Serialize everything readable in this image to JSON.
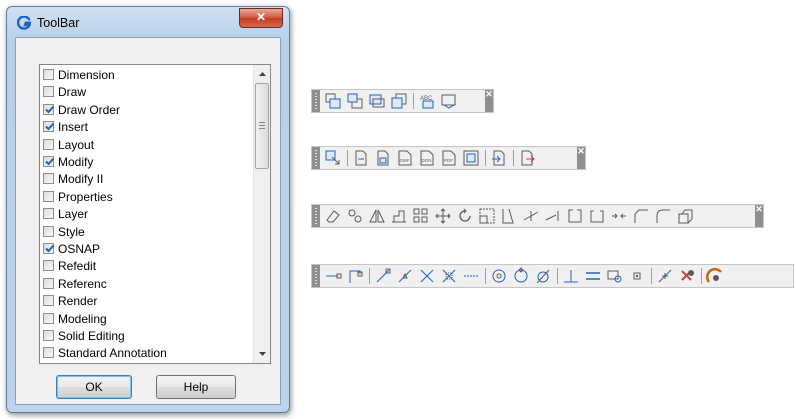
{
  "dialog": {
    "title": "ToolBar",
    "close_glyph": "✕",
    "items": [
      {
        "label": "Dimension",
        "checked": false
      },
      {
        "label": "Draw",
        "checked": false
      },
      {
        "label": "Draw Order",
        "checked": true
      },
      {
        "label": "Insert",
        "checked": true
      },
      {
        "label": "Layout",
        "checked": false
      },
      {
        "label": "Modify",
        "checked": true
      },
      {
        "label": "Modify II",
        "checked": false
      },
      {
        "label": "Properties",
        "checked": false
      },
      {
        "label": "Layer",
        "checked": false
      },
      {
        "label": "Style",
        "checked": false
      },
      {
        "label": "OSNAP",
        "checked": true
      },
      {
        "label": "Refedit",
        "checked": false
      },
      {
        "label": "Referenc",
        "checked": false
      },
      {
        "label": "Render",
        "checked": false
      },
      {
        "label": "Modeling",
        "checked": false
      },
      {
        "label": "Solid Editing",
        "checked": false
      },
      {
        "label": "Standard Annotation",
        "checked": false
      }
    ],
    "ok_label": "OK",
    "help_label": "Help"
  },
  "toolbars": {
    "draw_order": {
      "icons": [
        "bring-to-front-icon",
        "send-to-back-icon",
        "bring-above-objects-icon",
        "send-under-objects-icon",
        "|",
        "text-to-front-icon",
        "hatch-to-back-icon"
      ]
    },
    "insert": {
      "icons": [
        "insert-block-icon",
        "|",
        "attach-xref-icon",
        "attach-image-icon",
        "attach-dwf-icon",
        "attach-dgn-icon",
        "attach-pdf-icon",
        "ole-object-icon",
        "|",
        "import-icon",
        "|",
        "export-icon"
      ]
    },
    "modify": {
      "icons": [
        "erase-icon",
        "copy-icon",
        "mirror-icon",
        "offset-icon",
        "array-icon",
        "move-icon",
        "rotate-icon",
        "scale-icon",
        "stretch-icon",
        "trim-icon",
        "extend-icon",
        "break-at-point-icon",
        "break-icon",
        "join-icon",
        "chamfer-icon",
        "fillet-icon",
        "explode-icon"
      ]
    },
    "osnap": {
      "icons": [
        "temporary-tracking-icon",
        "snap-from-icon",
        "|",
        "endpoint-icon",
        "midpoint-icon",
        "intersection-icon",
        "apparent-intersection-icon",
        "extension-icon",
        "|",
        "center-icon",
        "quadrant-icon",
        "tangent-icon",
        "|",
        "perpendicular-icon",
        "parallel-icon",
        "insertion-icon",
        "node-icon",
        "|",
        "nearest-icon",
        "snap-none-icon",
        "|",
        "osnap-settings-icon"
      ]
    }
  },
  "colors": {
    "accent_blue": "#1e63c4",
    "close_red": "#c8452d",
    "icon_gray": "#5a5a5a"
  }
}
